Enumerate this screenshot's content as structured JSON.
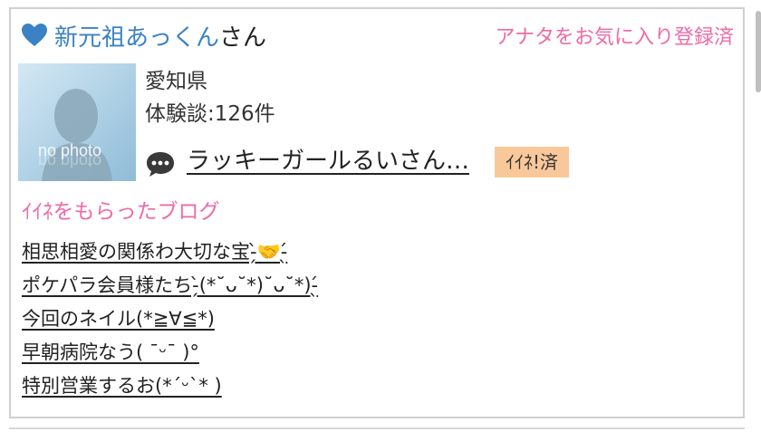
{
  "user": {
    "name": "新元祖あっくん",
    "suffix": "さん",
    "favorite_status": "アナタをお気に入り登録済"
  },
  "avatar": {
    "placeholder_text": "no photo"
  },
  "profile": {
    "location": "愛知県",
    "reviews": "体験談:126件"
  },
  "latest_review": {
    "icon": "chat-bubble-icon",
    "text": "ラッキーガールるいさん…",
    "badge": "ｲｲﾈ!済"
  },
  "liked_blogs": {
    "title": "ｲｲﾈをもらったブログ",
    "items": [
      {
        "text": "相思相愛の関係わ大切な宝-̗̀🤝-̖́"
      },
      {
        "text": "ポケパラ会員様たち-̗̀(*˘ᴗ˘*)˘ᴗ˘*)-̖́"
      },
      {
        "text": "今回のネイル(*≧∀≦*)"
      },
      {
        "text": "早朝病院なう( ¯ᵕ¯ )°"
      },
      {
        "text": "特別営業するお(*ˊᵕˋ* )"
      }
    ]
  },
  "colors": {
    "name_blue": "#3b82c4",
    "accent_pink": "#ee6aa7",
    "badge_orange": "#f9c89a",
    "avatar_bg": "#b6d6ea"
  }
}
